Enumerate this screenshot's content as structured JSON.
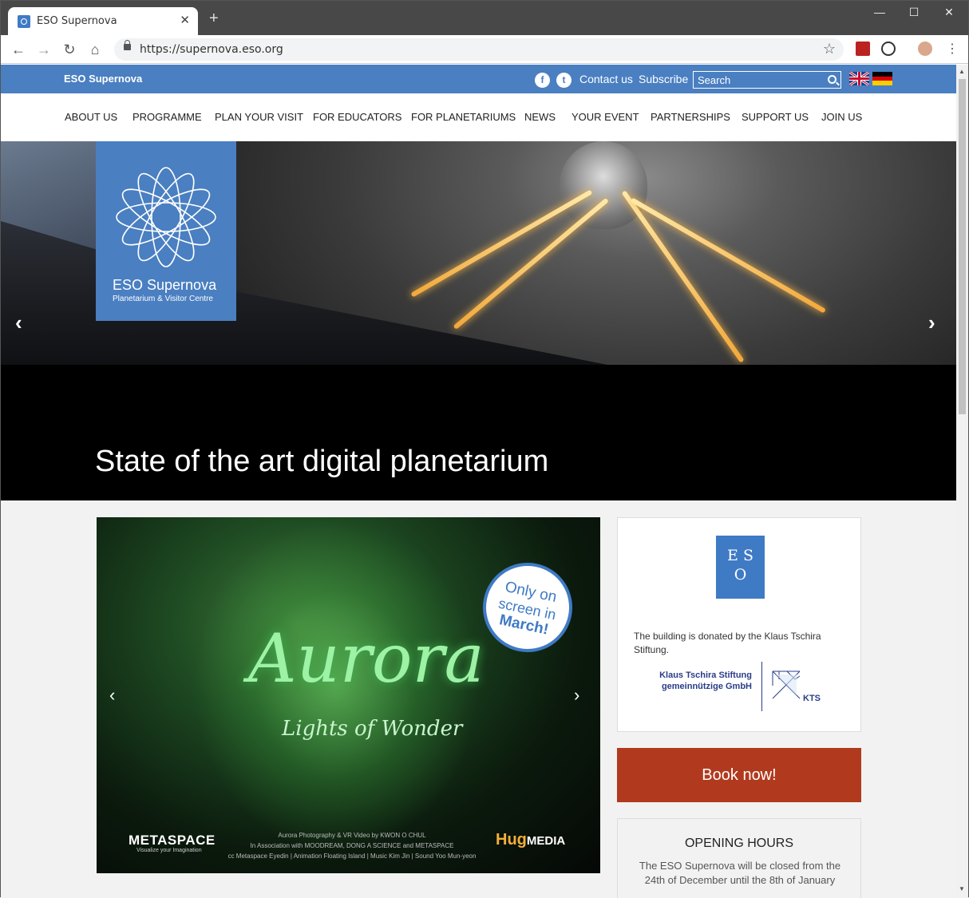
{
  "browser": {
    "tab_title": "ESO Supernova",
    "tab_close": "✕",
    "new_tab": "+",
    "url": "https://supernova.eso.org",
    "back": "←",
    "forward": "→",
    "reload": "↻",
    "home": "⌂",
    "star": "☆",
    "minimize": "—",
    "maximize": "☐",
    "close": "✕"
  },
  "topbar": {
    "brand": "ESO Supernova",
    "facebook": "f",
    "twitter": "t",
    "contact": "Contact us",
    "subscribe": "Subscribe",
    "search_placeholder": "Search"
  },
  "nav": [
    "ABOUT US",
    "PROGRAMME",
    "PLAN YOUR VISIT",
    "FOR EDUCATORS",
    "FOR PLANETARIUMS",
    "NEWS",
    "YOUR EVENT",
    "PARTNERSHIPS",
    "SUPPORT US",
    "JOIN US"
  ],
  "hero": {
    "logo_title": "ESO Supernova",
    "logo_sub": "Planetarium & Visitor Centre",
    "caption": "State of the art digital planetarium",
    "prev": "‹",
    "next": "›"
  },
  "promo": {
    "title": "Aurora",
    "subtitle": "Lights of Wonder",
    "badge_line1": "Only on",
    "badge_line2": "screen in",
    "badge_line3": "March!",
    "left_logo": "METASPACE",
    "left_logo_sub": "Visualize your Imagination",
    "credits_line1": "Aurora Photography & VR Video by KWON O CHUL",
    "credits_line2": "In Association with MOODREAM, DONG A SCIENCE and METASPACE",
    "credits_line3": "cc Metaspace Eyedin | Animation Floating Island | Music Kim Jin | Sound Yoo Mun-yeon",
    "right_logo": "Hug",
    "right_logo_2": "MEDIA",
    "prev": "‹",
    "next": "›"
  },
  "sidebar": {
    "eso_letters": [
      "E S",
      "O"
    ],
    "donated": "The building is donated by the Klaus Tschira Stiftung.",
    "kts_line1": "Klaus Tschira Stiftung",
    "kts_line2": "gemeinnützige GmbH",
    "kts_abbrev": "KTS",
    "book_label": "Book now!",
    "hours_title": "OPENING HOURS",
    "hours_text": "The ESO Supernova will be closed from the 24th of December until the 8th of January"
  },
  "colors": {
    "brand_blue": "#4a7fc1",
    "book_red": "#b13a1e",
    "aurora_green": "#9ef2a6"
  }
}
